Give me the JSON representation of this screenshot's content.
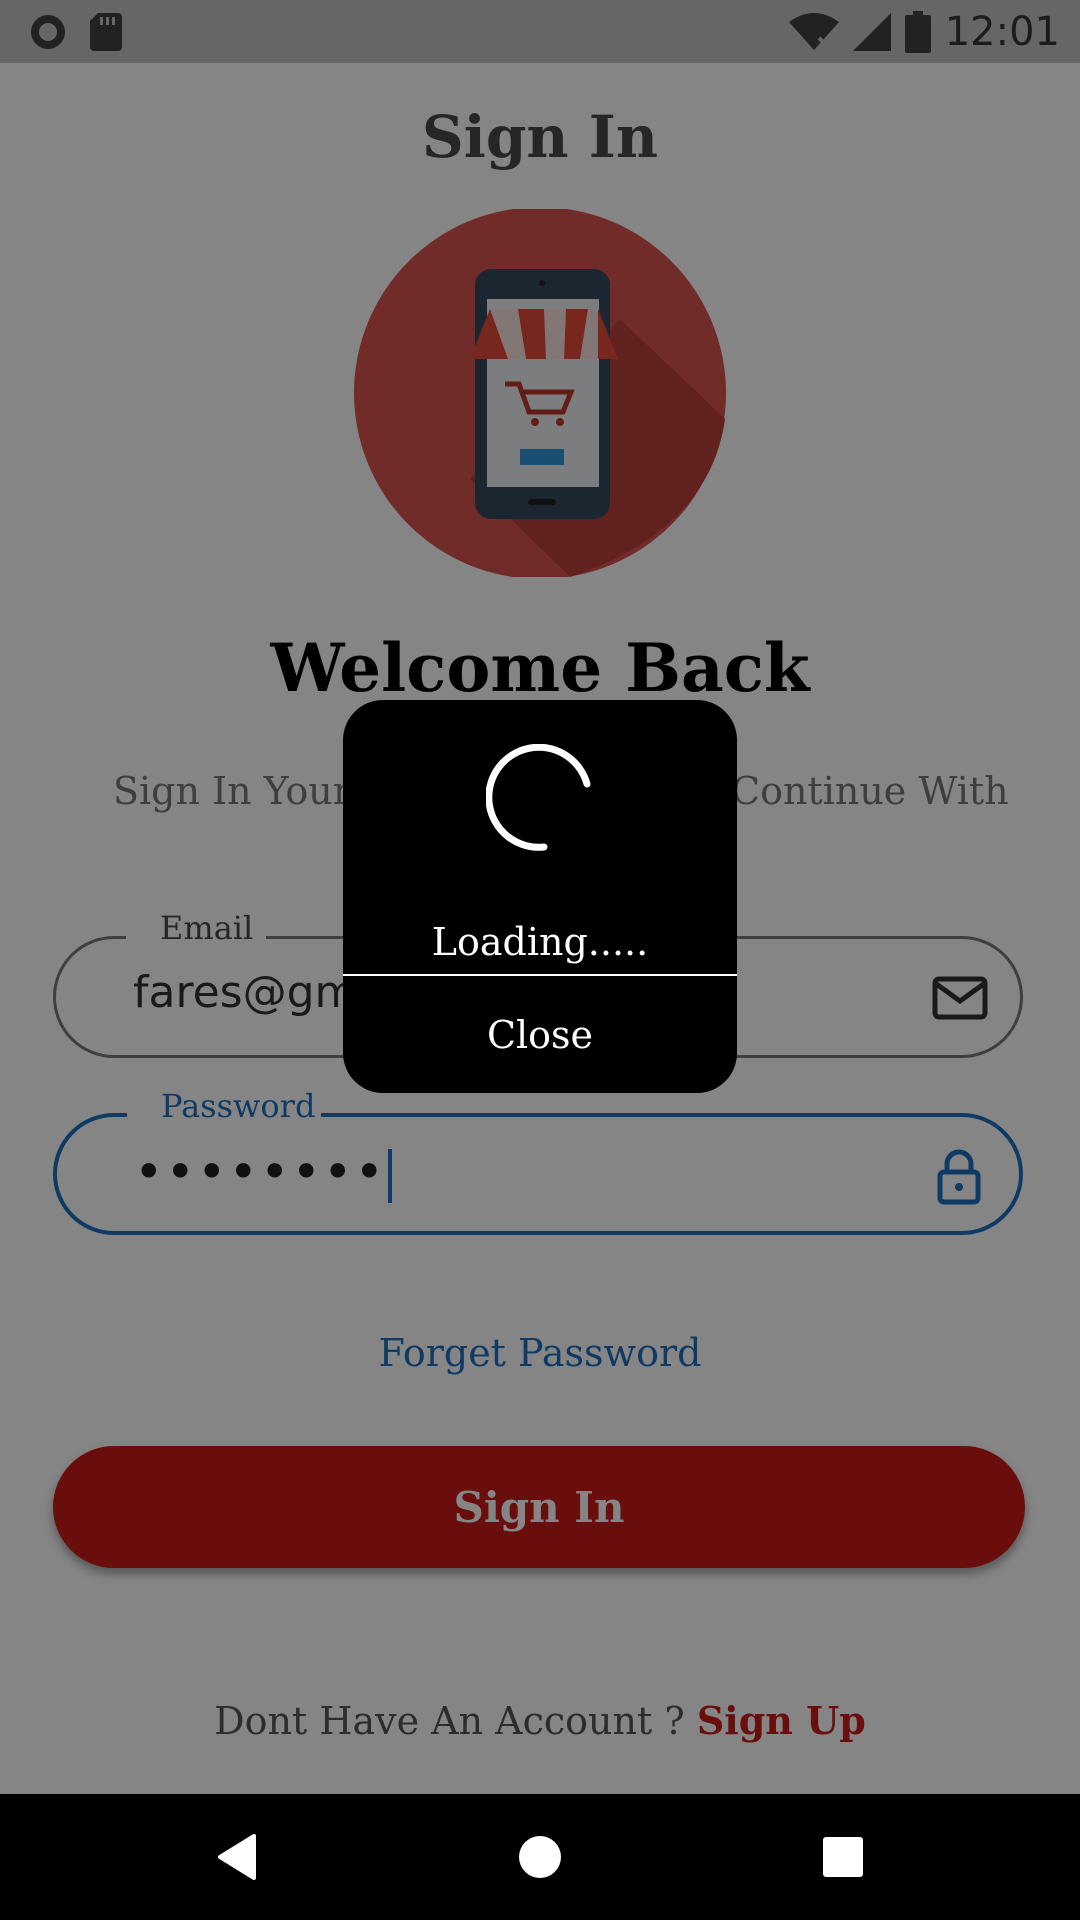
{
  "status_bar": {
    "time": "12:01",
    "icons": [
      "circle-notification-icon",
      "sd-card-icon",
      "wifi-off-icon",
      "signal-icon",
      "battery-icon"
    ]
  },
  "page": {
    "title": "Sign In",
    "welcome": "Welcome Back",
    "subtitle_left": "Sign In Your E",
    "subtitle_right": "Continue With"
  },
  "email_field": {
    "label": "Email",
    "value": "fares@gma",
    "icon": "mail-icon"
  },
  "password_field": {
    "label": "Password",
    "value": "••••••••",
    "icon": "lock-icon"
  },
  "links": {
    "forget_password": "Forget Password"
  },
  "signin_button": {
    "label": "Sign In"
  },
  "signup": {
    "prompt": "Dont Have An Account ?",
    "link": "Sign Up"
  },
  "dialog": {
    "message": "Loading.....",
    "close_label": "Close"
  },
  "colors": {
    "accent_red": "#c91a1a",
    "accent_blue": "#1e6fc0",
    "scrim": "rgba(0,0,0,0.48)"
  },
  "nav_bar": {
    "buttons": [
      "back-icon",
      "home-icon",
      "recents-icon"
    ]
  }
}
